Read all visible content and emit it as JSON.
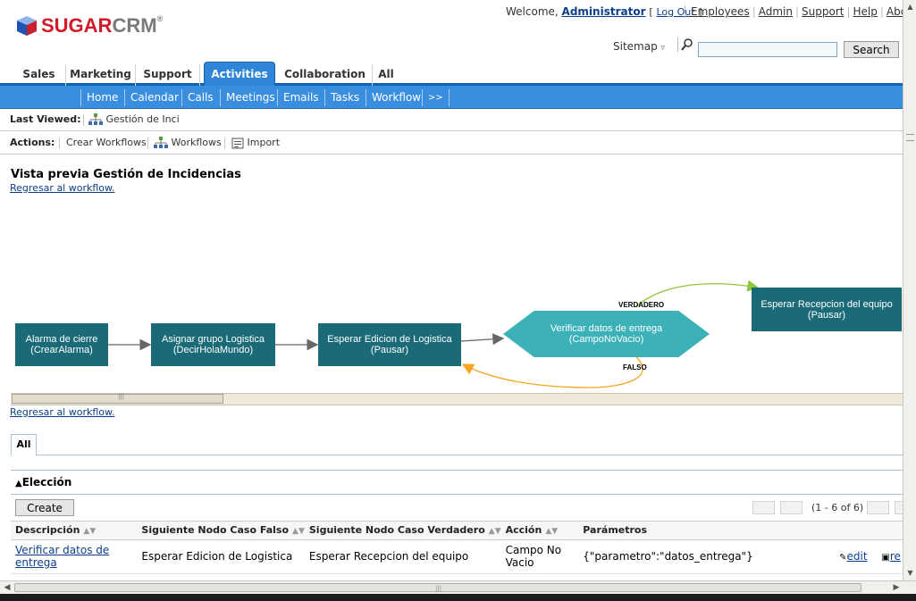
{
  "header": {
    "logo_sugar": "SUGAR",
    "logo_crm": "CRM",
    "logo_reg": "®",
    "welcome_prefix": "Welcome,",
    "user_name": "Administrator",
    "logout_label": "Log Out",
    "top_links": [
      "Employees",
      "Admin",
      "Support",
      "Help",
      "About"
    ],
    "sitemap_label": "Sitemap",
    "search_value": "",
    "search_button": "Search"
  },
  "module_tabs": [
    {
      "label": "Sales",
      "active": false
    },
    {
      "label": "Marketing",
      "active": false
    },
    {
      "label": "Support",
      "active": false
    },
    {
      "label": "Activities",
      "active": true
    },
    {
      "label": "Collaboration",
      "active": false
    },
    {
      "label": "All",
      "active": false
    }
  ],
  "sub_tabs": [
    "Home",
    "Calendar",
    "Calls",
    "Meetings",
    "Emails",
    "Tasks",
    "Workflow",
    ">>"
  ],
  "last_viewed": {
    "label": "Last Viewed:",
    "item": "Gestión de Inci"
  },
  "actions": {
    "label": "Actions:",
    "items": [
      "Crear Workflows",
      "Workflows",
      "Import"
    ]
  },
  "main": {
    "title": "Vista previa Gestión de Incidencias",
    "back_link": "Regresar al workflow."
  },
  "diagram": {
    "nodes": [
      {
        "line1": "Alarma de cierre",
        "line2": "(CrearAlarma)"
      },
      {
        "line1": "Asignar grupo Logistica",
        "line2": "(DecirHolaMundo)"
      },
      {
        "line1": "Esperar Edicion de Logistica",
        "line2": "(Pausar)"
      },
      {
        "line1": "Verificar datos de entrega",
        "line2": "(CampoNoVacio)"
      },
      {
        "line1": "Esperar Recepcion del equipo",
        "line2": "(Pausar)"
      }
    ],
    "label_true": "VERDADERO",
    "label_false": "FALSO",
    "colors": {
      "node": "#1b6a78",
      "decision": "#3cb1b8",
      "true_edge": "#8ec63f",
      "false_edge": "#f5a623",
      "edge": "#666666"
    }
  },
  "subpanel": {
    "tab_label": "All",
    "title": "Elección",
    "create_label": "Create",
    "pager_text": "(1 - 6 of 6)",
    "columns": [
      "Descripción",
      "Siguiente Nodo Caso Falso",
      "Siguiente Nodo Caso Verdadero",
      "Acción",
      "Parámetros"
    ],
    "rows": [
      {
        "descripcion": "Verificar datos de entrega",
        "falso": "Esperar Edicion de Logistica",
        "verdadero": "Esperar Recepcion del equipo",
        "accion": "Campo No Vacio",
        "parametros": "{\"parametro\":\"datos_entrega\"}",
        "edit_label": "edit",
        "remove_label": "re"
      }
    ]
  }
}
